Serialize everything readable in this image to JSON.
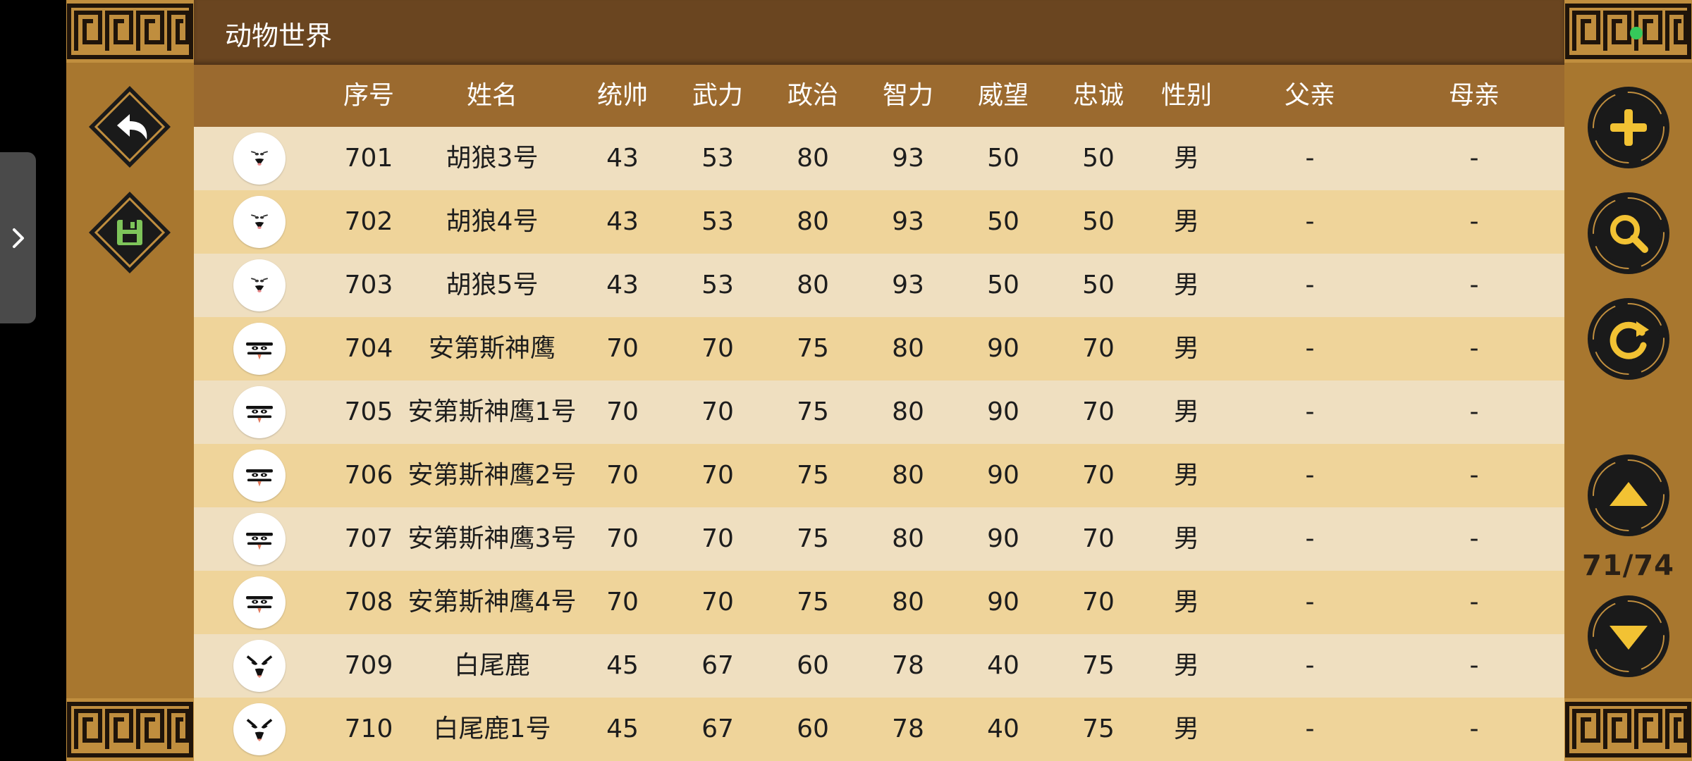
{
  "window": {
    "title": "动物世界"
  },
  "nav": {
    "page_indicator": "71/74"
  },
  "table": {
    "headers": [
      "序号",
      "姓名",
      "统帅",
      "武力",
      "政治",
      "智力",
      "威望",
      "忠诚",
      "性别",
      "父亲",
      "母亲"
    ],
    "rows": [
      {
        "id": "701",
        "name": "胡狼3号",
        "lead": "43",
        "war": "53",
        "pol": "80",
        "int": "93",
        "fame": "50",
        "loyal": "50",
        "sex": "男",
        "father": "-",
        "mother": "-",
        "avatar": "jackal-face-icon"
      },
      {
        "id": "702",
        "name": "胡狼4号",
        "lead": "43",
        "war": "53",
        "pol": "80",
        "int": "93",
        "fame": "50",
        "loyal": "50",
        "sex": "男",
        "father": "-",
        "mother": "-",
        "avatar": "jackal-face-icon"
      },
      {
        "id": "703",
        "name": "胡狼5号",
        "lead": "43",
        "war": "53",
        "pol": "80",
        "int": "93",
        "fame": "50",
        "loyal": "50",
        "sex": "男",
        "father": "-",
        "mother": "-",
        "avatar": "jackal-face-icon"
      },
      {
        "id": "704",
        "name": "安第斯神鹰",
        "lead": "70",
        "war": "70",
        "pol": "75",
        "int": "80",
        "fame": "90",
        "loyal": "70",
        "sex": "男",
        "father": "-",
        "mother": "-",
        "avatar": "condor-face-icon"
      },
      {
        "id": "705",
        "name": "安第斯神鹰1号",
        "lead": "70",
        "war": "70",
        "pol": "75",
        "int": "80",
        "fame": "90",
        "loyal": "70",
        "sex": "男",
        "father": "-",
        "mother": "-",
        "avatar": "condor-face-icon"
      },
      {
        "id": "706",
        "name": "安第斯神鹰2号",
        "lead": "70",
        "war": "70",
        "pol": "75",
        "int": "80",
        "fame": "90",
        "loyal": "70",
        "sex": "男",
        "father": "-",
        "mother": "-",
        "avatar": "condor-face-icon"
      },
      {
        "id": "707",
        "name": "安第斯神鹰3号",
        "lead": "70",
        "war": "70",
        "pol": "75",
        "int": "80",
        "fame": "90",
        "loyal": "70",
        "sex": "男",
        "father": "-",
        "mother": "-",
        "avatar": "condor-face-icon"
      },
      {
        "id": "708",
        "name": "安第斯神鹰4号",
        "lead": "70",
        "war": "70",
        "pol": "75",
        "int": "80",
        "fame": "90",
        "loyal": "70",
        "sex": "男",
        "father": "-",
        "mother": "-",
        "avatar": "condor-face-icon"
      },
      {
        "id": "709",
        "name": "白尾鹿",
        "lead": "45",
        "war": "67",
        "pol": "60",
        "int": "78",
        "fame": "40",
        "loyal": "75",
        "sex": "男",
        "father": "-",
        "mother": "-",
        "avatar": "deer-face-icon"
      },
      {
        "id": "710",
        "name": "白尾鹿1号",
        "lead": "45",
        "war": "67",
        "pol": "60",
        "int": "78",
        "fame": "40",
        "loyal": "75",
        "sex": "男",
        "father": "-",
        "mother": "-",
        "avatar": "deer-face-icon"
      }
    ]
  },
  "colors": {
    "panel": "#a8772f",
    "title_bar": "#6a4520",
    "header_row": "#9b6a2f",
    "row_light": "#efdfc0",
    "row_dark": "#efd49a",
    "button_fill": "#1a1a1a",
    "button_accent": "#f2c233",
    "save_accent": "#7ec45a",
    "status_dot": "#35c95a"
  }
}
